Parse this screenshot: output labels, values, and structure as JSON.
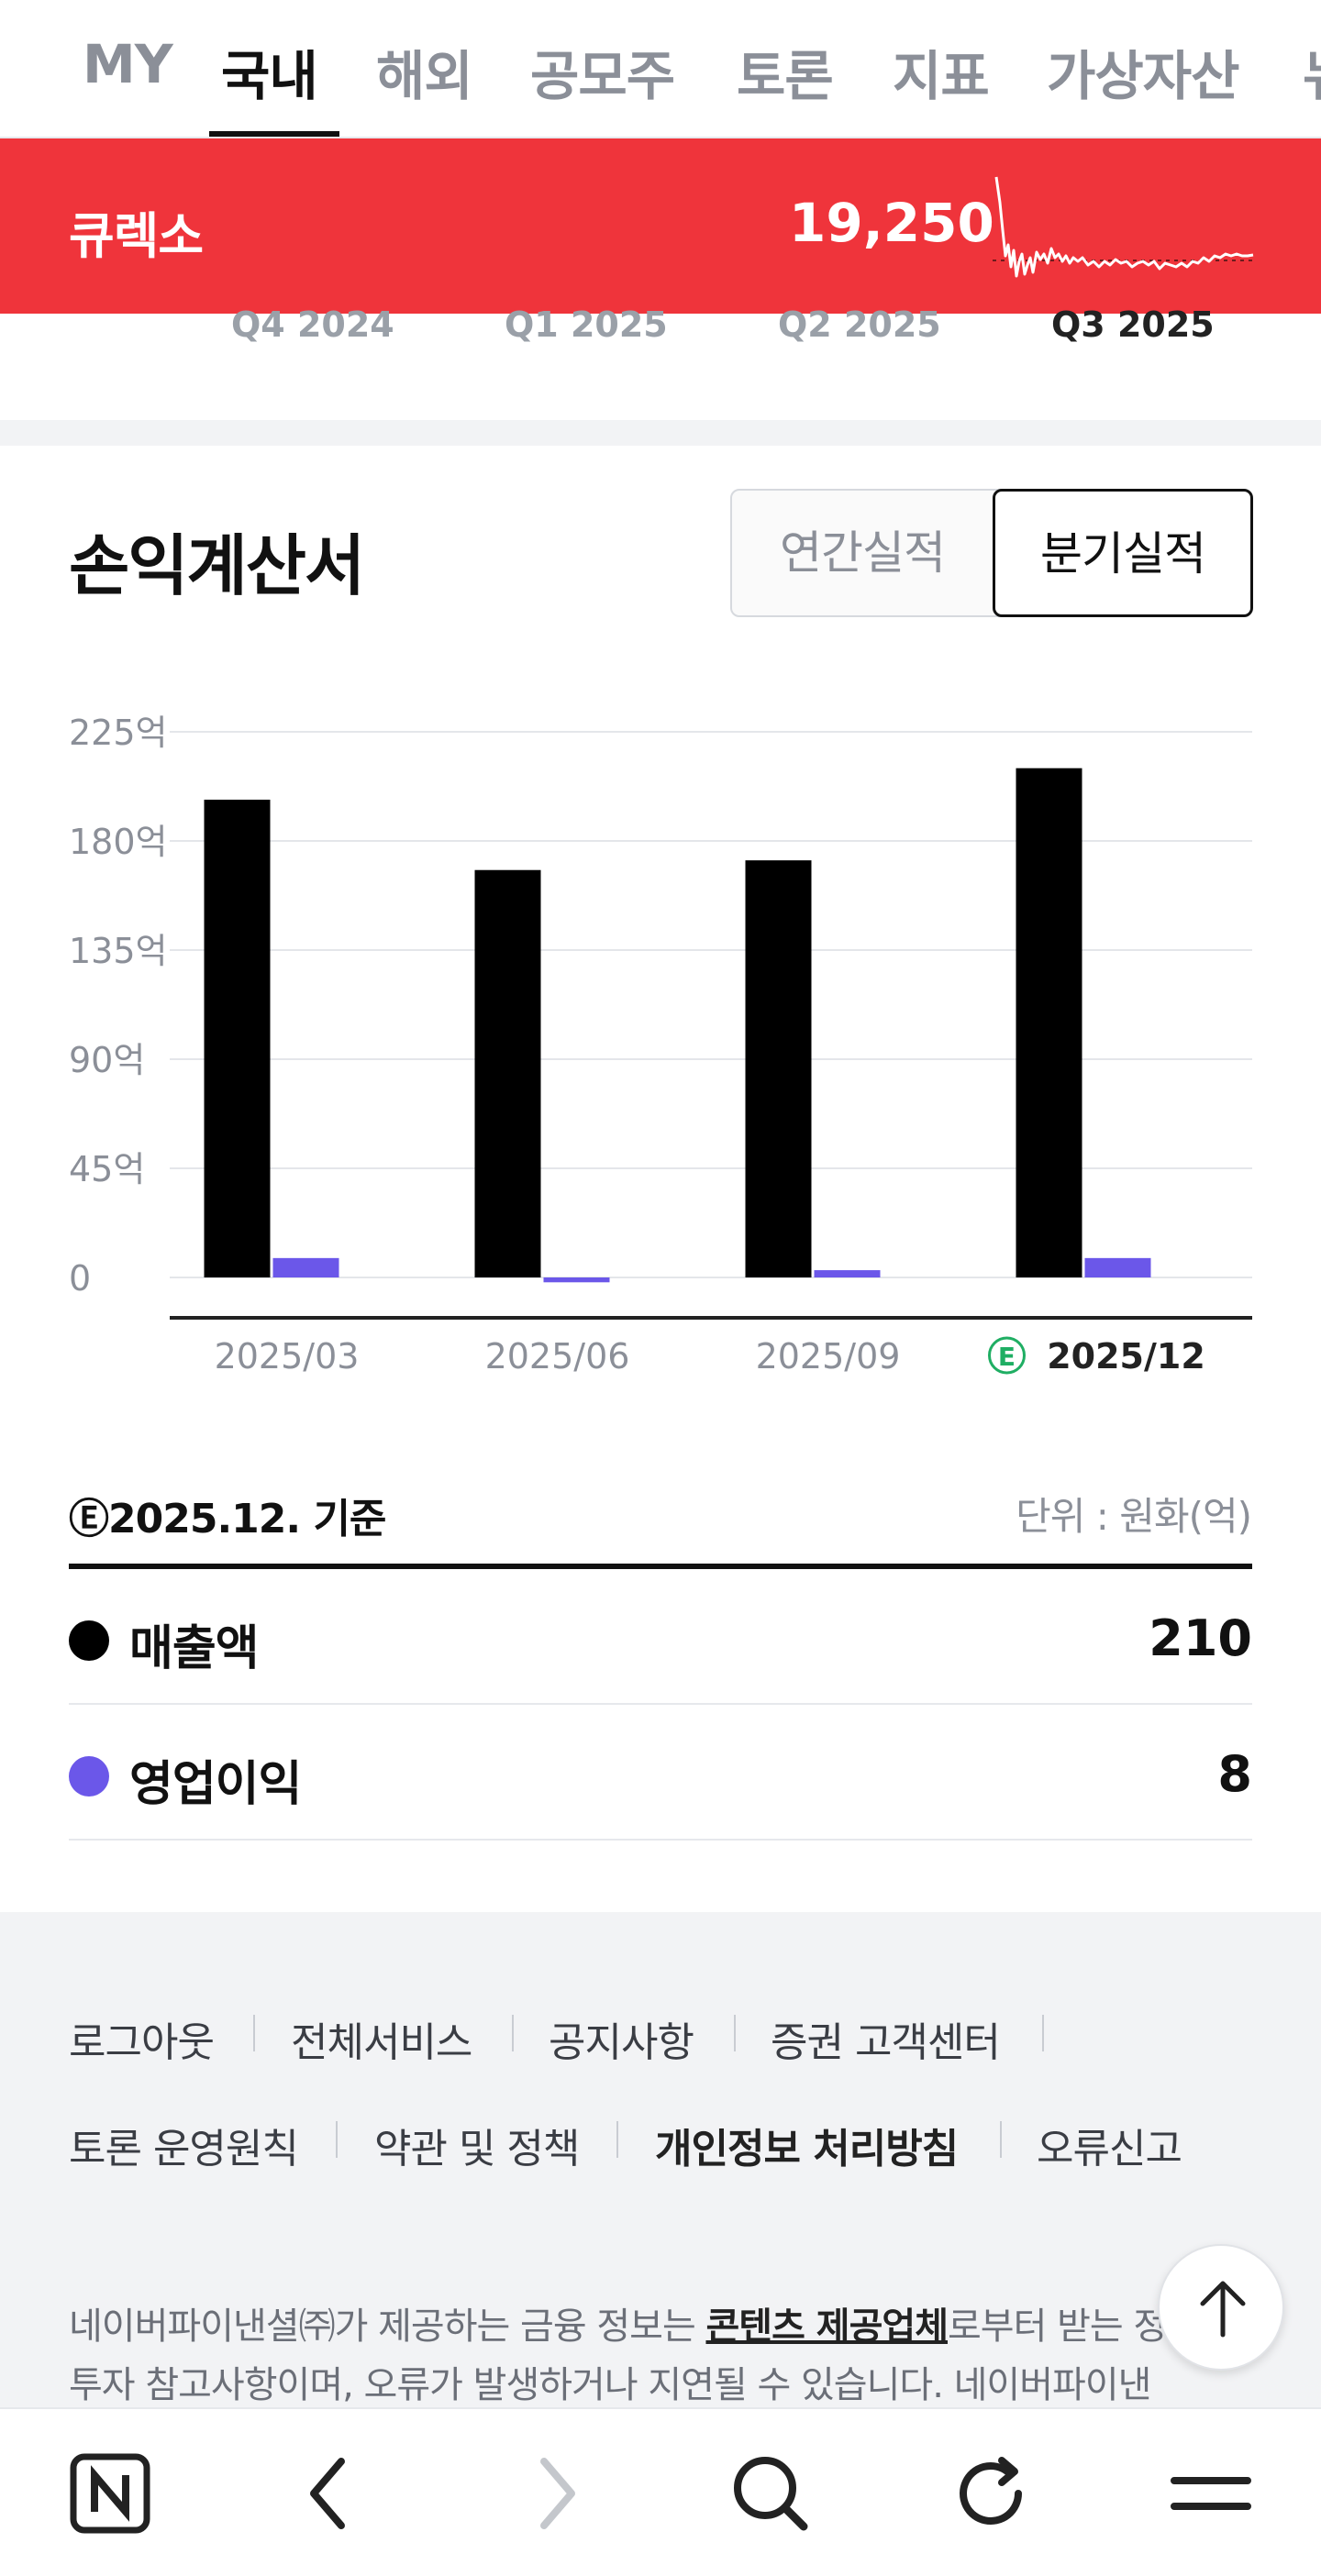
{
  "nav": {
    "tabs": [
      "MY",
      "국내",
      "해외",
      "공모주",
      "토론",
      "지표",
      "가상자산",
      "뉴"
    ],
    "active_index": 1
  },
  "stock": {
    "name": "큐렉소",
    "price": "19,250",
    "color": "#ef343b"
  },
  "prev_chart": {
    "labels": [
      "Q4 2024",
      "Q1 2025",
      "Q2 2025",
      "Q3 2025"
    ],
    "active_index": 3
  },
  "section": {
    "title": "손익계산서",
    "toggle": {
      "annual": "연간실적",
      "quarterly": "분기실적",
      "selected": "quarterly"
    }
  },
  "chart_data": {
    "type": "bar",
    "categories": [
      "2025/03",
      "2025/06",
      "2025/09",
      "2025/12"
    ],
    "estimate_marker": "E",
    "estimate_index": 3,
    "series": [
      {
        "name": "매출액",
        "color": "#000000",
        "values": [
          197,
          168,
          172,
          210
        ]
      },
      {
        "name": "영업이익",
        "color": "#6b57e9",
        "values": [
          8,
          -2,
          3,
          8
        ]
      }
    ],
    "ylim": [
      0,
      225
    ],
    "yticks": [
      0,
      45,
      90,
      135,
      180,
      225
    ],
    "ytick_labels": [
      "0",
      "45억",
      "90억",
      "135억",
      "180억",
      "225억"
    ],
    "grid": true
  },
  "summary": {
    "basis": "Ⓔ2025.12. 기준",
    "unit": "단위 : 원화(억)",
    "rows": [
      {
        "label": "매출액",
        "value": "210",
        "color": "#000000"
      },
      {
        "label": "영업이익",
        "value": "8",
        "color": "#6b57e9"
      }
    ]
  },
  "footer": {
    "links_row1": [
      "로그아웃",
      "전체서비스",
      "공지사항",
      "증권 고객센터"
    ],
    "links_row2": [
      "토론 운영원칙",
      "약관 및 정책",
      "개인정보 처리방침",
      "오류신고"
    ],
    "notice_pre": "네이버파이낸셜㈜가 제공하는 금융 정보는 ",
    "notice_link": "콘텐츠 제공업체",
    "notice_post": "로부터 받는 정보로 투자 참고사항이며, 오류가 발생하거나 지연될 수 있습니다. 네이버파이낸"
  },
  "bottombar": {
    "icons": [
      "naver-home-icon",
      "back-icon",
      "forward-icon",
      "search-icon",
      "refresh-icon",
      "menu-icon"
    ]
  }
}
